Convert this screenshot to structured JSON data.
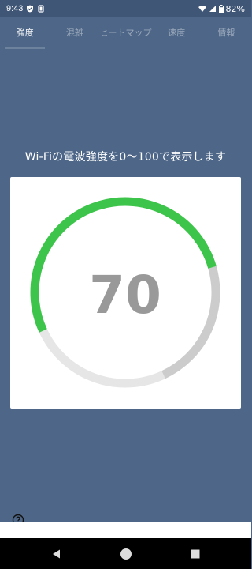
{
  "status_bar": {
    "time": "9:43",
    "battery": "82%"
  },
  "tabs": [
    {
      "label": "強度",
      "active": true
    },
    {
      "label": "混雑",
      "active": false
    },
    {
      "label": "ヒートマップ",
      "active": false
    },
    {
      "label": "速度",
      "active": false
    },
    {
      "label": "情報",
      "active": false
    }
  ],
  "description": "Wi-Fiの電波強度を0〜100で表示します",
  "gauge": {
    "value": 70,
    "value_label": "70",
    "max": 100,
    "colors": {
      "active_arc": "#3dc44a",
      "right_arc": "#cccccc",
      "bottom_arc": "#e6e6e6",
      "value_text": "#999999"
    }
  },
  "icons": {
    "help": "help-circle-icon",
    "nav_back": "triangle-back-icon",
    "nav_home": "circle-home-icon",
    "nav_recents": "square-recents-icon"
  }
}
